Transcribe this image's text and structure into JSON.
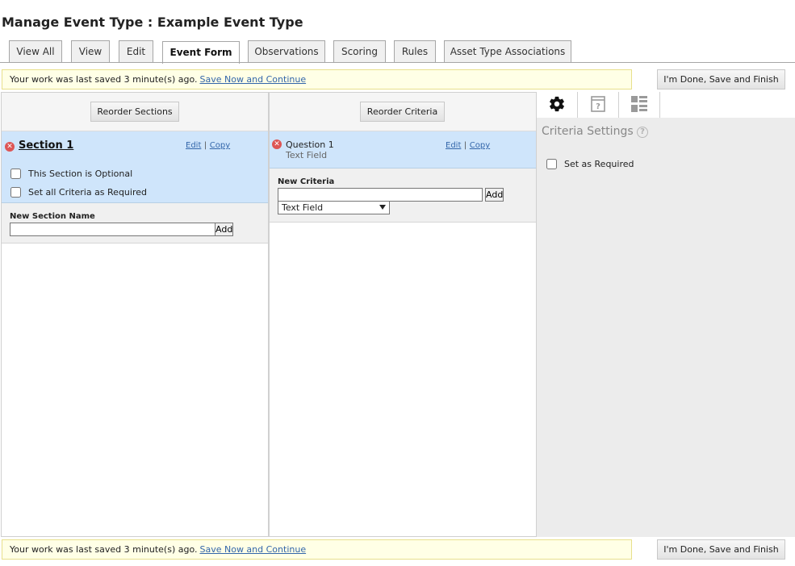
{
  "page": {
    "title": "Manage Event Type : Example Event Type"
  },
  "tabs": [
    {
      "label": "View All"
    },
    {
      "label": "View"
    },
    {
      "label": "Edit"
    },
    {
      "label": "Event Form"
    },
    {
      "label": "Observations"
    },
    {
      "label": "Scoring"
    },
    {
      "label": "Rules"
    },
    {
      "label": "Asset Type Associations"
    }
  ],
  "savebar": {
    "message": "Your work was last saved 3 minute(s) ago.",
    "link": "Save Now and Continue",
    "finish_label": "I'm Done, Save and Finish"
  },
  "sections_panel": {
    "reorder_label": "Reorder Sections",
    "section": {
      "name": "Section 1",
      "edit": "Edit",
      "copy": "Copy",
      "separator": "|",
      "optional_label": "This Section is Optional",
      "required_label": "Set all Criteria as Required"
    },
    "new_label": "New Section Name",
    "add_label": "Add"
  },
  "criteria_panel": {
    "reorder_label": "Reorder Criteria",
    "criterion": {
      "name": "Question 1",
      "type": "Text Field",
      "edit": "Edit",
      "copy": "Copy",
      "separator": "|"
    },
    "new_label": "New Criteria",
    "add_label": "Add",
    "type_select_value": "Text Field"
  },
  "settings_panel": {
    "title": "Criteria Settings",
    "help_glyph": "?",
    "required_label": "Set as Required",
    "tab_icons": [
      "gear-icon",
      "help-card-icon",
      "list-layout-icon"
    ]
  },
  "colors": {
    "selected_row": "#cfe5fb",
    "save_bar": "#ffffe6",
    "delete_icon": "#dd5555",
    "link": "#3366aa"
  }
}
